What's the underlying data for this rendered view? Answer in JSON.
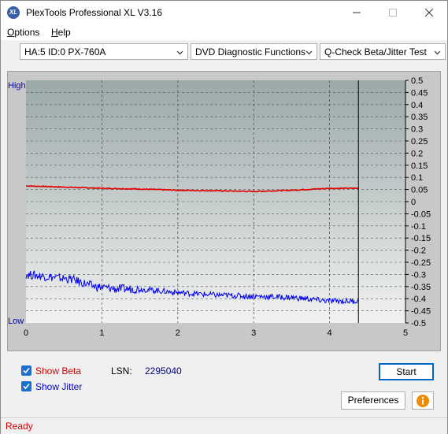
{
  "window": {
    "title": "PlexTools Professional XL V3.16",
    "icon_text": "XL"
  },
  "menu": {
    "options": "ptions",
    "options_mnemonic": "O",
    "help": "elp",
    "help_mnemonic": "H"
  },
  "toolbar": {
    "device": "HA:5 ID:0  PX-760A",
    "function": "DVD Diagnostic Functions",
    "test": "Q-Check Beta/Jitter Test"
  },
  "chart": {
    "left_label_high": "High",
    "left_label_low": "Low",
    "colors": {
      "beta": "#e00000",
      "jitter": "#0000ee",
      "bg_top": "#9aa8a8",
      "bg_bottom": "#f2f2f2"
    }
  },
  "chart_data": {
    "type": "line",
    "xlim": [
      0,
      5
    ],
    "x_ticks": [
      "0",
      "1",
      "2",
      "3",
      "4",
      "5"
    ],
    "ylim": [
      -0.5,
      0.5
    ],
    "y_ticks": [
      "0.5",
      "0.45",
      "0.4",
      "0.35",
      "0.3",
      "0.25",
      "0.2",
      "0.15",
      "0.1",
      "0.05",
      "0",
      "-0.05",
      "-0.1",
      "-0.15",
      "-0.2",
      "-0.25",
      "-0.3",
      "-0.35",
      "-0.4",
      "-0.45",
      "-0.5"
    ],
    "end_marker_x": 4.38,
    "series": [
      {
        "name": "Beta",
        "color": "#e00000",
        "x": [
          0,
          0.5,
          1.0,
          1.5,
          2.0,
          2.5,
          3.0,
          3.5,
          4.0,
          4.38
        ],
        "y": [
          0.065,
          0.06,
          0.055,
          0.052,
          0.047,
          0.045,
          0.042,
          0.047,
          0.055,
          0.055
        ]
      },
      {
        "name": "Jitter",
        "color": "#0000ee",
        "x": [
          0,
          0.3,
          0.6,
          0.9,
          1.2,
          1.5,
          2.0,
          2.5,
          3.0,
          3.5,
          4.0,
          4.38
        ],
        "y": [
          -0.3,
          -0.31,
          -0.32,
          -0.35,
          -0.36,
          -0.36,
          -0.375,
          -0.385,
          -0.39,
          -0.395,
          -0.41,
          -0.41
        ]
      }
    ]
  },
  "controls": {
    "show_beta": "Show Beta",
    "show_jitter": "Show Jitter",
    "lsn_label": "LSN:",
    "lsn_value": "2295040",
    "start": "Start",
    "preferences": "Preferences",
    "show_beta_checked": true,
    "show_jitter_checked": true
  },
  "status": {
    "text": "Ready"
  }
}
